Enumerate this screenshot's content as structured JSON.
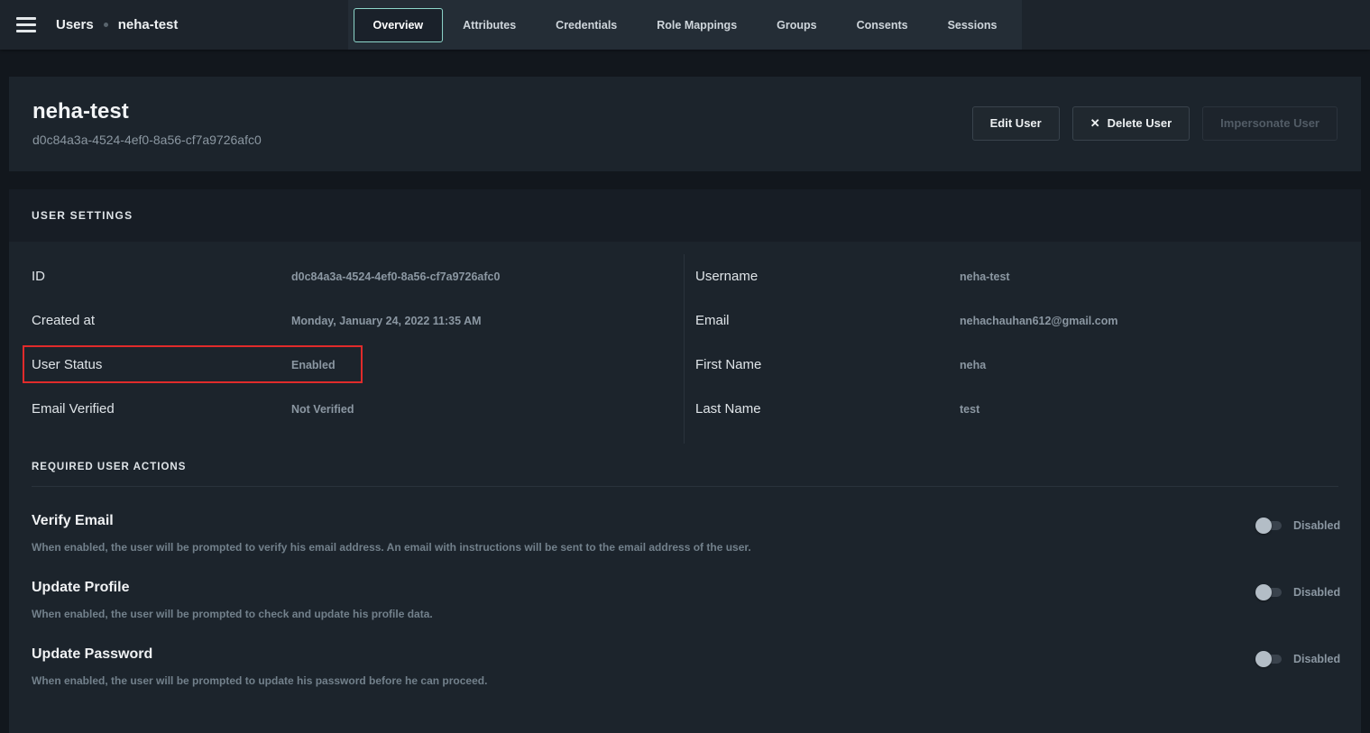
{
  "topbar": {
    "breadcrumb": {
      "root": "Users",
      "current": "neha-test"
    },
    "tabs": [
      {
        "label": "Overview",
        "active": true
      },
      {
        "label": "Attributes",
        "active": false
      },
      {
        "label": "Credentials",
        "active": false
      },
      {
        "label": "Role Mappings",
        "active": false
      },
      {
        "label": "Groups",
        "active": false
      },
      {
        "label": "Consents",
        "active": false
      },
      {
        "label": "Sessions",
        "active": false
      }
    ]
  },
  "header": {
    "title": "neha-test",
    "subtitle": "d0c84a3a-4524-4ef0-8a56-cf7a9726afc0",
    "buttons": {
      "edit": "Edit User",
      "delete": "Delete User",
      "delete_icon": "✕",
      "impersonate": "Impersonate User",
      "impersonate_enabled": false
    }
  },
  "user_settings": {
    "section_title": "USER SETTINGS",
    "left": [
      {
        "label": "ID",
        "value": "d0c84a3a-4524-4ef0-8a56-cf7a9726afc0",
        "highlighted": false
      },
      {
        "label": "Created at",
        "value": "Monday, January 24, 2022 11:35 AM",
        "highlighted": false
      },
      {
        "label": "User Status",
        "value": "Enabled",
        "highlighted": true
      },
      {
        "label": "Email Verified",
        "value": "Not Verified",
        "highlighted": false
      }
    ],
    "right": [
      {
        "label": "Username",
        "value": "neha-test"
      },
      {
        "label": "Email",
        "value": "nehachauhan612@gmail.com"
      },
      {
        "label": "First Name",
        "value": "neha"
      },
      {
        "label": "Last Name",
        "value": "test"
      }
    ]
  },
  "required_actions": {
    "section_title": "REQUIRED USER ACTIONS",
    "items": [
      {
        "title": "Verify Email",
        "description": "When enabled, the user will be prompted to verify his email address. An email with instructions will be sent to the email address of the user.",
        "state": "Disabled",
        "enabled": false
      },
      {
        "title": "Update Profile",
        "description": "When enabled, the user will be prompted to check and update his profile data.",
        "state": "Disabled",
        "enabled": false
      },
      {
        "title": "Update Password",
        "description": "When enabled, the user will be prompted to update his password before he can proceed.",
        "state": "Disabled",
        "enabled": false
      }
    ]
  },
  "colors": {
    "topbar_bg": "#1d242c",
    "page_bg": "#12171d",
    "card_bg": "#1c242c",
    "card_header_bg": "#171d25",
    "active_tab_border": "#8ed8cc",
    "annotation_red": "#e02b2b",
    "muted_text": "#8b97a2"
  }
}
